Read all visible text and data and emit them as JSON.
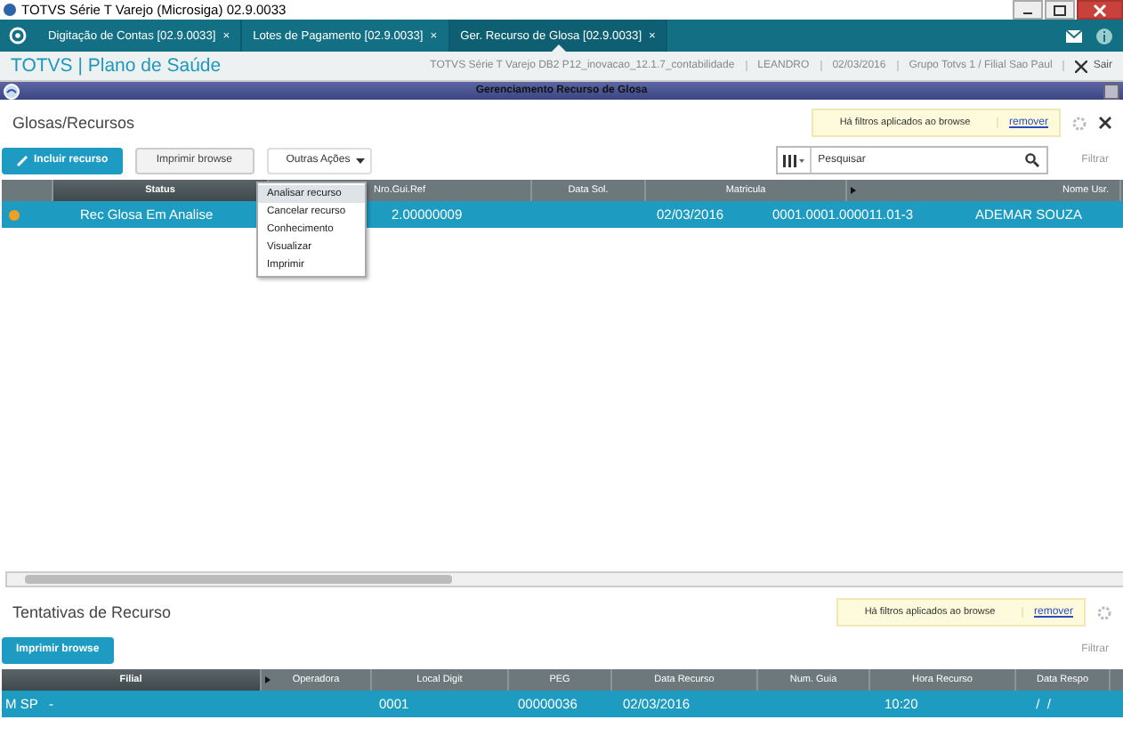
{
  "window": {
    "title": "TOTVS Série T Varejo (Microsiga) 02.9.0033"
  },
  "tabs": [
    {
      "label": "Digitação de Contas [02.9.0033]",
      "close": "×",
      "selected": false
    },
    {
      "label": "Lotes de Pagamento [02.9.0033]",
      "close": "×",
      "selected": false
    },
    {
      "label": "Ger. Recurso de Glosa [02.9.0033]",
      "close": "×",
      "selected": true
    }
  ],
  "header": {
    "brand": "TOTVS | Plano de Saúde",
    "info": [
      "TOTVS Série T Varejo DB2 P12_inovacao_12.1.7_contabilidade",
      "LEANDRO",
      "02/03/2016",
      "Grupo Totvs 1 / Filial Sao Paul"
    ],
    "exit": "Sair"
  },
  "dialog": {
    "title": "Gerenciamento Recurso de Glosa"
  },
  "top": {
    "title": "Glosas/Recursos",
    "filter_notice": "Há filtros aplicados ao browse",
    "remove_link": "remover",
    "buttons": [
      {
        "label": "Incluir recurso",
        "kind": "primary"
      },
      {
        "label": "Imprimir browse",
        "kind": "secondary"
      },
      {
        "label": "Outras Ações",
        "kind": "dropdown"
      }
    ],
    "search": {
      "placeholder": "Pesquisar"
    },
    "filter": "Filtrar",
    "columns": [
      {
        "label": "Status",
        "sorted": true,
        "marker": false
      },
      {
        "label": "Nro.Gui.Ref",
        "sorted": false
      },
      {
        "label": "Data Sol.",
        "sorted": false,
        "marker": false
      },
      {
        "label": "Matricula",
        "sorted": false,
        "marker": false
      },
      {
        "label": "Nome Usr.",
        "sorted": false,
        "marker": true
      }
    ],
    "rows": [
      {
        "selected": true,
        "color": "#f0a020",
        "cells": [
          "Rec Glosa Em Analise",
          "2.00000009",
          "02/03/2016",
          "0001.0001.000011.01-3",
          "ADEMAR SOUZA"
        ]
      }
    ],
    "menu": [
      {
        "label": "Analisar recurso",
        "selected": true
      },
      {
        "label": "Cancelar recurso",
        "selected": false
      },
      {
        "label": "Conhecimento",
        "selected": false
      },
      {
        "label": "Visualizar",
        "selected": false
      },
      {
        "label": "Imprimir",
        "selected": false
      }
    ]
  },
  "bottom": {
    "title": "Tentativas de Recurso",
    "filter_notice": "Há filtros aplicados ao browse",
    "remove_link": "remover",
    "button": "Imprimir browse",
    "filter": "Filtrar",
    "columns": [
      {
        "label": "Filial",
        "sorted": true,
        "marker": false
      },
      {
        "label": "Operadora",
        "sorted": false,
        "marker": true
      },
      {
        "label": "Local Digit",
        "sorted": false,
        "marker": false
      },
      {
        "label": "PEG",
        "sorted": false,
        "marker": false
      },
      {
        "label": "Data Recurso",
        "sorted": false,
        "marker": false
      },
      {
        "label": "Num. Guia",
        "sorted": false,
        "marker": false
      },
      {
        "label": "Hora Recurso",
        "sorted": false,
        "marker": false
      },
      {
        "label": "Data Respo",
        "sorted": false,
        "marker": false
      }
    ],
    "rows": [
      {
        "selected": true,
        "cells": [
          "M SP   -",
          "",
          "0001",
          "00000036",
          "02/03/2016",
          "",
          "10:20",
          " /  /"
        ]
      }
    ]
  }
}
